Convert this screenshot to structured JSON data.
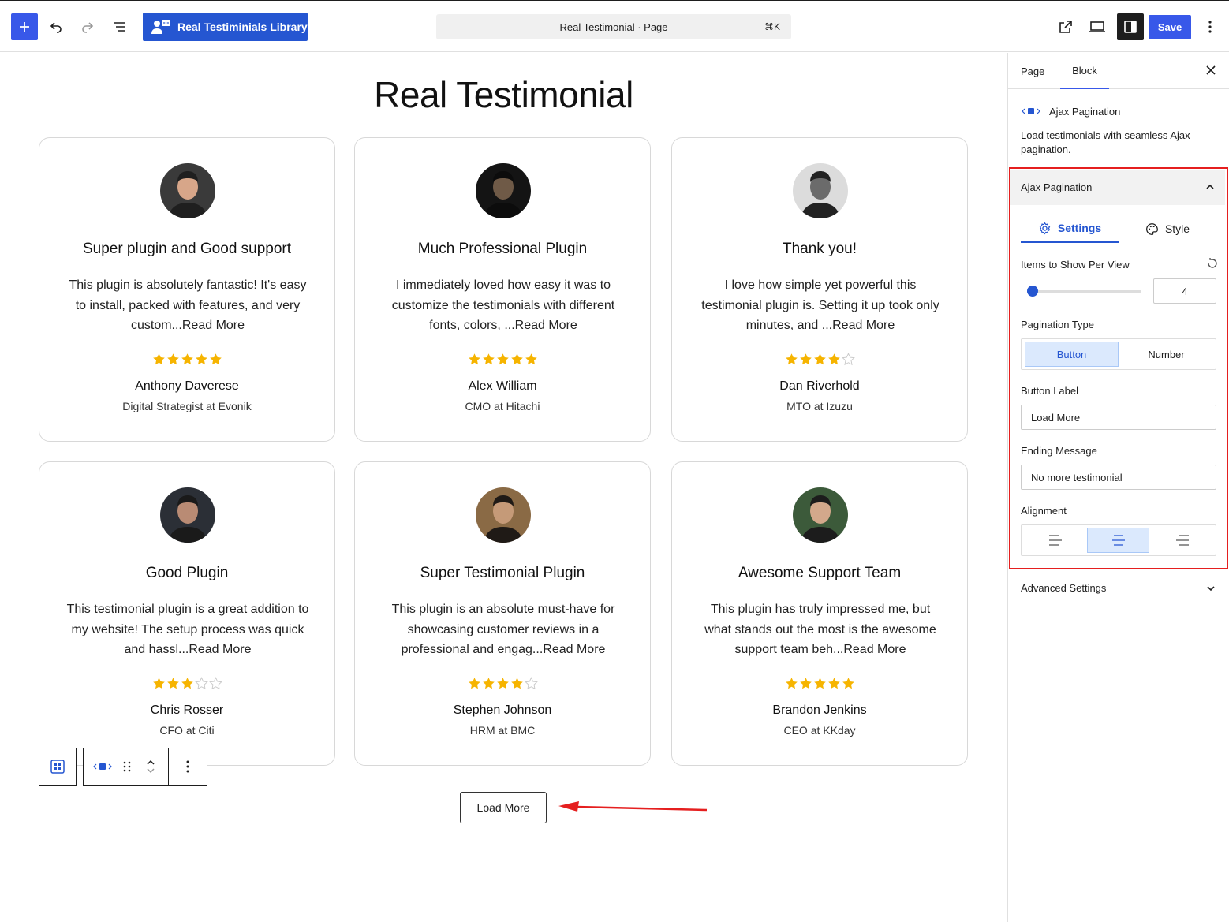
{
  "toolbar": {
    "library_label": "Real Testiminials Library",
    "command_title": "Real Testimonial · Page",
    "command_shortcut": "⌘K",
    "save_label": "Save"
  },
  "canvas": {
    "title": "Real Testimonial",
    "load_more_label": "Load More",
    "testimonials": [
      {
        "title": "Super plugin and Good support",
        "text": "This plugin is absolutely fantastic! It's easy to install, packed with features, and very custom...Read More",
        "rating": 5,
        "name": "Anthony Daverese",
        "role": "Digital Strategist at Evonik"
      },
      {
        "title": "Much Professional Plugin",
        "text": "I immediately loved how easy it was to customize the testimonials with different fonts, colors, ...Read More",
        "rating": 5,
        "name": "Alex William",
        "role": "CMO at Hitachi"
      },
      {
        "title": "Thank you!",
        "text": "I love how simple yet powerful this testimonial plugin is. Setting it up took only minutes, and ...Read More",
        "rating": 4,
        "name": "Dan Riverhold",
        "role": "MTO at Izuzu"
      },
      {
        "title": "Good Plugin",
        "text": "This testimonial plugin is a great addition to my website! The setup process was quick and hassl...Read More",
        "rating": 3,
        "name": "Chris Rosser",
        "role": "CFO at Citi"
      },
      {
        "title": "Super Testimonial Plugin",
        "text": "This plugin is an absolute must-have for showcasing customer reviews in a professional and engag...Read More",
        "rating": 4,
        "name": "Stephen Johnson",
        "role": "HRM at BMC"
      },
      {
        "title": "Awesome Support Team",
        "text": "This plugin has truly impressed me, but what stands out the most is the awesome support team beh...Read More",
        "rating": 5,
        "name": "Brandon Jenkins",
        "role": "CEO at KKday"
      }
    ]
  },
  "sidebar": {
    "tab_page": "Page",
    "tab_block": "Block",
    "block_title": "Ajax Pagination",
    "block_desc": "Load testimonials with seamless Ajax pagination.",
    "panel_title": "Ajax Pagination",
    "subtab_settings": "Settings",
    "subtab_style": "Style",
    "items_label": "Items to Show Per View",
    "items_value": "4",
    "items_fraction": 0.05,
    "pagination_type_label": "Pagination Type",
    "pagination_options": [
      "Button",
      "Number"
    ],
    "button_label_label": "Button Label",
    "button_label_value": "Load More",
    "ending_label": "Ending Message",
    "ending_value": "No more testimonial",
    "alignment_label": "Alignment",
    "alignment_selected": "center",
    "advanced_label": "Advanced Settings"
  },
  "colors": {
    "accent": "#3858e9",
    "brand": "#2556d1",
    "star": "#f6b400",
    "highlight": "#e51f1f"
  }
}
